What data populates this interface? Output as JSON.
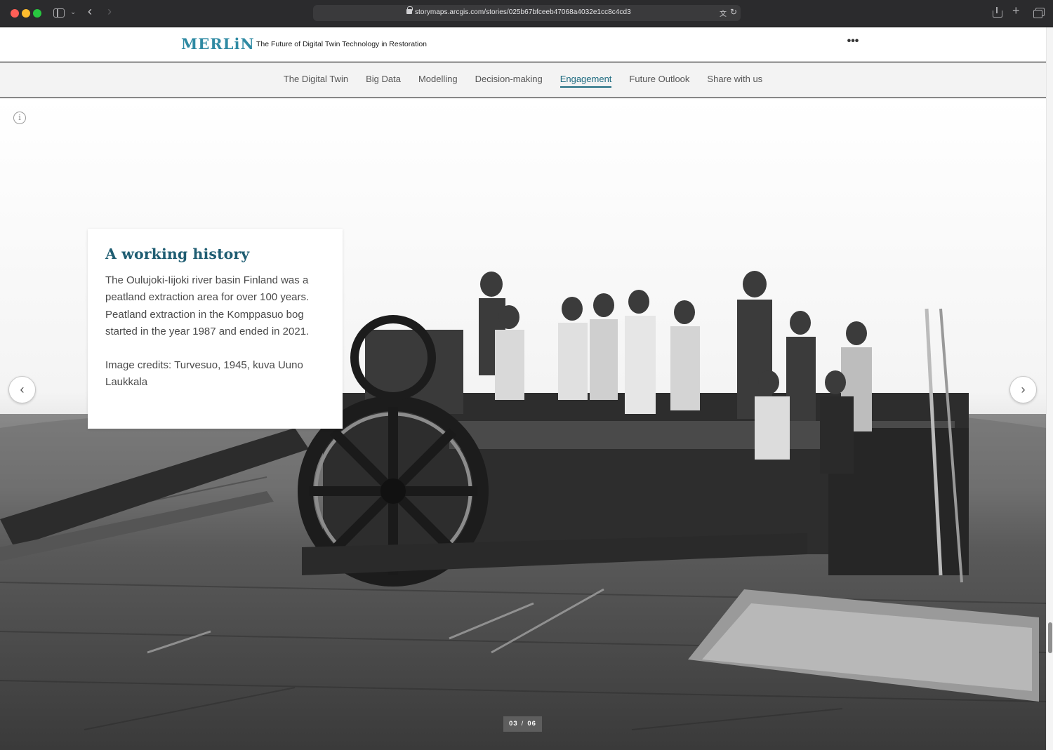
{
  "browser": {
    "url": "storymaps.arcgis.com/stories/025b67bfceeb47068a4032e1cc8c4cd3"
  },
  "header": {
    "logo_text": "MERLiN",
    "title": "The Future of Digital Twin Technology in Restoration",
    "more_label": "•••"
  },
  "nav": {
    "items": [
      {
        "label": "The Digital Twin",
        "active": false
      },
      {
        "label": "Big Data",
        "active": false
      },
      {
        "label": "Modelling",
        "active": false
      },
      {
        "label": "Decision-making",
        "active": false
      },
      {
        "label": "Engagement",
        "active": true
      },
      {
        "label": "Future Outlook",
        "active": false
      },
      {
        "label": "Share with us",
        "active": false
      }
    ]
  },
  "slide": {
    "heading": "A working history",
    "body": "The Oulujoki-Iijoki river basin Finland was a peatland extraction area for over 100 years. Peatland extraction in the Komppasuo bog started in the year 1987 and ended in 2021.",
    "credit": "Image credits: Turvesuo, 1945, kuva Uuno Laukkala",
    "current": "03",
    "separator": "/",
    "total": "06"
  },
  "icons": {
    "info": "info-icon",
    "prev": "chevron-left-icon",
    "next": "chevron-right-icon"
  },
  "colors": {
    "accent": "#1f5d72",
    "logo_light": "#2f8aa3"
  }
}
